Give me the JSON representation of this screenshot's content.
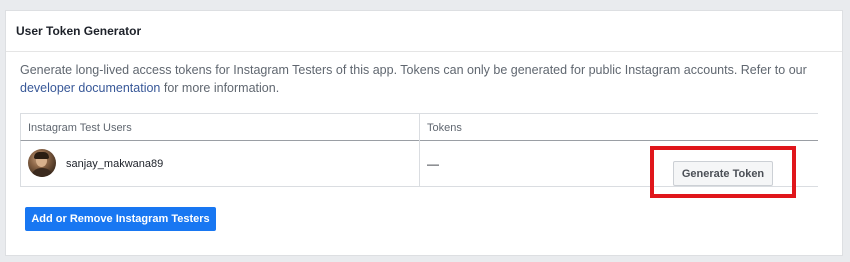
{
  "panel": {
    "title": "User Token Generator"
  },
  "description": {
    "text_before_link": "Generate long-lived access tokens for Instagram Testers of this app. Tokens can only be generated for public Instagram accounts. Refer to our ",
    "link_text": "developer documentation",
    "text_after_link": " for more information."
  },
  "table": {
    "columns": [
      "Instagram Test Users",
      "Tokens"
    ],
    "rows": [
      {
        "username": "sanjay_makwana89",
        "token": "—",
        "action_label": "Generate Token"
      }
    ]
  },
  "actions": {
    "add_remove_label": "Add or Remove Instagram Testers"
  },
  "colors": {
    "primary_button": "#1877f2",
    "highlight_border": "#e0161b",
    "link": "#385898",
    "page_background": "#e9ebee"
  },
  "icons": {
    "avatar": "user-profile-photo"
  }
}
